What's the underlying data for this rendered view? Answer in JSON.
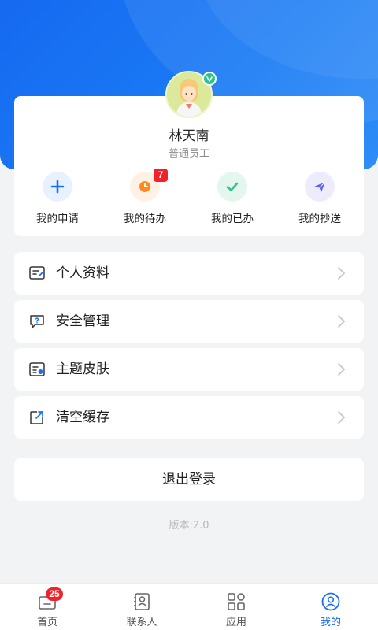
{
  "profile": {
    "name": "林天南",
    "role": "普通员工"
  },
  "quick_actions": [
    {
      "label": "我的申请",
      "icon": "plus-icon",
      "color": "#1a6ff0"
    },
    {
      "label": "我的待办",
      "icon": "clock-icon",
      "color": "#ff8a1f",
      "badge": "7"
    },
    {
      "label": "我的已办",
      "icon": "check-icon",
      "color": "#2bc48a"
    },
    {
      "label": "我的抄送",
      "icon": "send-icon",
      "color": "#5b5ef0"
    }
  ],
  "menu": [
    {
      "label": "个人资料",
      "icon": "profile-card-icon"
    },
    {
      "label": "安全管理",
      "icon": "security-chat-icon"
    },
    {
      "label": "主题皮肤",
      "icon": "theme-icon"
    },
    {
      "label": "清空缓存",
      "icon": "clear-cache-icon"
    }
  ],
  "logout_label": "退出登录",
  "version": "版本:2.0",
  "tabs": [
    {
      "label": "首页",
      "icon": "home-icon",
      "badge": "25"
    },
    {
      "label": "联系人",
      "icon": "contacts-icon"
    },
    {
      "label": "应用",
      "icon": "apps-grid-icon"
    },
    {
      "label": "我的",
      "icon": "me-icon",
      "active": true
    }
  ],
  "colors": {
    "primary": "#1a6ff0",
    "badge_red": "#f0222b",
    "verified_green": "#2bc48a"
  }
}
